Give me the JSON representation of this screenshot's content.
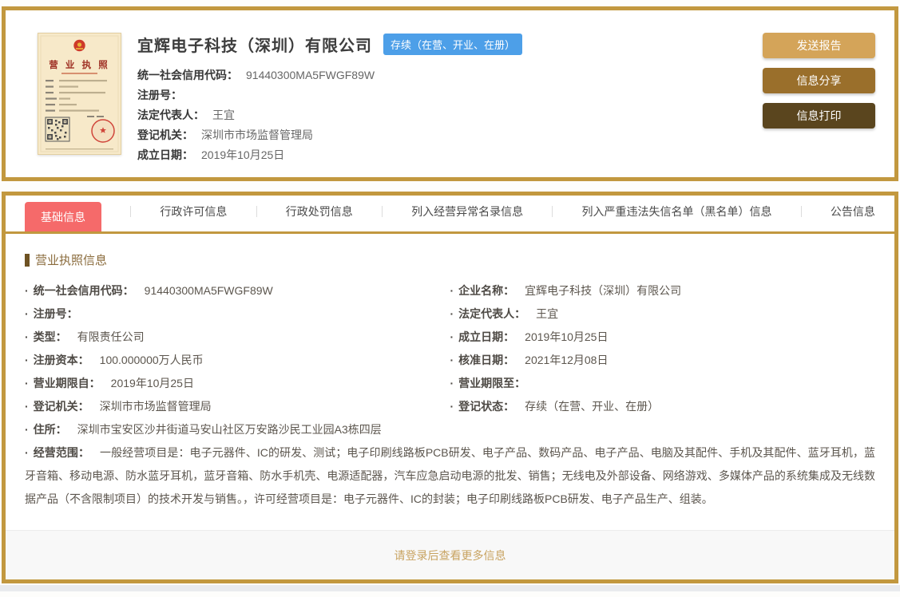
{
  "header_card": {
    "company_name": "宜辉电子科技（深圳）有限公司",
    "status_badge": "存续（在营、开业、在册）",
    "license": {
      "title": "营 业 执 照"
    },
    "fields": [
      {
        "label": "统一社会信用代码：",
        "value": "91440300MA5FWGF89W"
      },
      {
        "label": "注册号：",
        "value": ""
      },
      {
        "label": "法定代表人：",
        "value": "王宜"
      },
      {
        "label": "登记机关：",
        "value": "深圳市市场监督管理局"
      },
      {
        "label": "成立日期：",
        "value": "2019年10月25日"
      }
    ],
    "buttons": [
      {
        "label": "发送报告",
        "color": "#D4A459"
      },
      {
        "label": "信息分享",
        "color": "#9A6F2B"
      },
      {
        "label": "信息打印",
        "color": "#5A451E"
      }
    ]
  },
  "tabs": [
    {
      "label": "基础信息",
      "active": true
    },
    {
      "label": "行政许可信息",
      "active": false
    },
    {
      "label": "行政处罚信息",
      "active": false
    },
    {
      "label": "列入经营异常名录信息",
      "active": false
    },
    {
      "label": "列入严重违法失信名单（黑名单）信息",
      "active": false
    },
    {
      "label": "公告信息",
      "active": false
    }
  ],
  "basic_info": {
    "section_title": "营业执照信息",
    "rows": [
      {
        "left": {
          "label": "统一社会信用代码：",
          "value": "91440300MA5FWGF89W"
        },
        "right": {
          "label": "企业名称：",
          "value": "宜辉电子科技（深圳）有限公司"
        }
      },
      {
        "left": {
          "label": "注册号：",
          "value": ""
        },
        "right": {
          "label": "法定代表人：",
          "value": "王宜"
        }
      },
      {
        "left": {
          "label": "类型：",
          "value": "有限责任公司"
        },
        "right": {
          "label": "成立日期：",
          "value": "2019年10月25日"
        }
      },
      {
        "left": {
          "label": "注册资本：",
          "value": "100.000000万人民币"
        },
        "right": {
          "label": "核准日期：",
          "value": "2021年12月08日"
        }
      },
      {
        "left": {
          "label": "营业期限自：",
          "value": "2019年10月25日"
        },
        "right": {
          "label": "营业期限至：",
          "value": ""
        }
      },
      {
        "left": {
          "label": "登记机关：",
          "value": "深圳市市场监督管理局"
        },
        "right": {
          "label": "登记状态：",
          "value": "存续（在营、开业、在册）"
        }
      }
    ],
    "address": {
      "label": "住所：",
      "value": "深圳市宝安区沙井街道马安山社区万安路沙民工业园A3栋四层"
    },
    "scope": {
      "label": "经营范围：",
      "value": "一般经营项目是：电子元器件、IC的研发、测试；电子印刷线路板PCB研发、电子产品、数码产品、电子产品、电脑及其配件、手机及其配件、蓝牙耳机，蓝牙音箱、移动电源、防水蓝牙耳机，蓝牙音箱、防水手机壳、电源适配器，汽车应急启动电源的批发、销售；无线电及外部设备、网络游戏、多媒体产品的系统集成及无线数据产品（不含限制项目）的技术开发与销售。，许可经营项目是：电子元器件、IC的封装；电子印刷线路板PCB研发、电子产品生产、组装。"
    }
  },
  "footer": {
    "login_prompt": "请登录后查看更多信息"
  },
  "colors": {
    "card_border": "#C2983F",
    "active_tab": "#F56A6A",
    "status_badge": "#4D9FE8",
    "btn_send_report": "#D4A459",
    "btn_share_info": "#9A6F2B",
    "btn_print_info": "#5A451E",
    "section_title": "#8A6B3C",
    "footer_link": "#C8A361"
  }
}
